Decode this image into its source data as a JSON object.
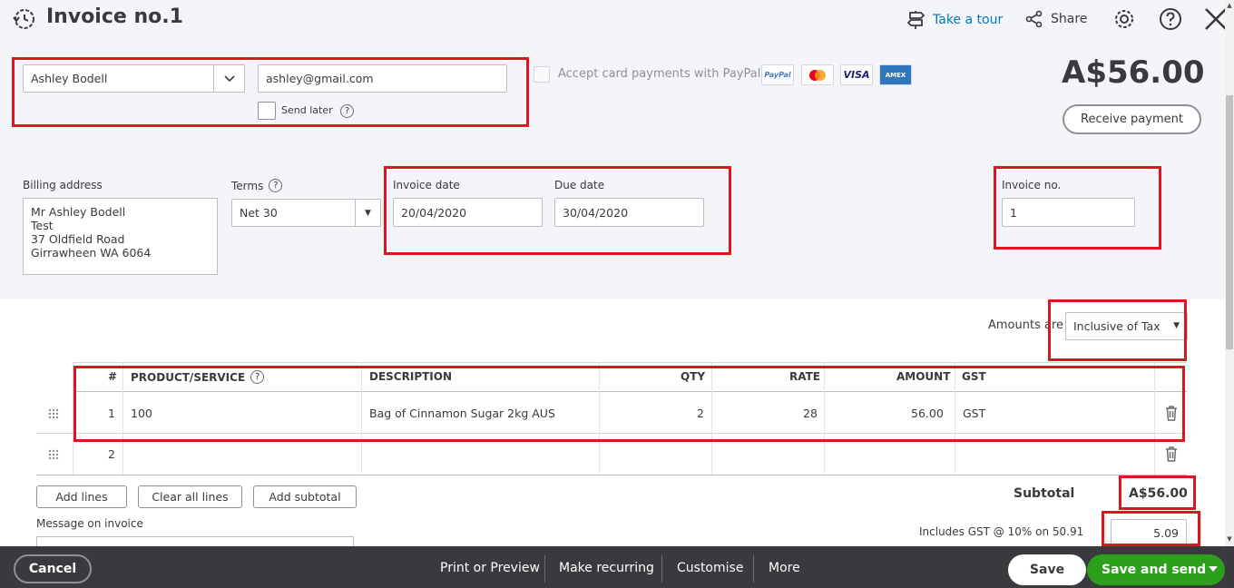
{
  "header": {
    "title": "Invoice no.1",
    "take_tour": "Take a tour",
    "share": "Share"
  },
  "customer": {
    "name": "Ashley Bodell",
    "email": "ashley@gmail.com",
    "send_later": "Send later"
  },
  "paypal": {
    "label": "Accept card payments with PayPal",
    "cards": [
      "PayPal",
      "MC",
      "VISA",
      "AMEX"
    ]
  },
  "balance": {
    "amount": "A$56.00",
    "receive_label": "Receive payment"
  },
  "billing": {
    "label": "Billing address",
    "lines": [
      "Mr Ashley Bodell",
      "Test",
      "37 Oldfield Road",
      "Girrawheen WA  6064"
    ]
  },
  "terms": {
    "label": "Terms",
    "value": "Net 30"
  },
  "dates": {
    "invoice_label": "Invoice date",
    "invoice_value": "20/04/2020",
    "due_label": "Due date",
    "due_value": "30/04/2020"
  },
  "invoice_no": {
    "label": "Invoice no.",
    "value": "1"
  },
  "amounts_are": {
    "label": "Amounts are",
    "value": "Inclusive of Tax"
  },
  "table": {
    "headers": [
      "#",
      "PRODUCT/SERVICE",
      "DESCRIPTION",
      "QTY",
      "RATE",
      "AMOUNT",
      "GST"
    ],
    "rows": [
      {
        "num": "1",
        "product": "100",
        "description": "Bag of Cinnamon Sugar 2kg AUS",
        "qty": "2",
        "rate": "28",
        "amount": "56.00",
        "gst": "GST"
      },
      {
        "num": "2",
        "product": "",
        "description": "",
        "qty": "",
        "rate": "",
        "amount": "",
        "gst": ""
      }
    ]
  },
  "actions": {
    "add_lines": "Add lines",
    "clear_lines": "Clear all lines",
    "add_subtotal": "Add subtotal"
  },
  "totals": {
    "subtotal_label": "Subtotal",
    "subtotal_value": "A$56.00",
    "gst_label": "Includes GST @ 10% on 50.91",
    "gst_value": "5.09"
  },
  "message": {
    "label": "Message on invoice"
  },
  "footer": {
    "cancel": "Cancel",
    "print": "Print or Preview",
    "recurring": "Make recurring",
    "customise": "Customise",
    "more": "More",
    "save": "Save",
    "save_send": "Save and send"
  },
  "colors": {
    "annotation_red": "#e0141e",
    "primary_green": "#2ca01c",
    "link_blue": "#0077c5",
    "footer_dark": "#393a3d"
  }
}
